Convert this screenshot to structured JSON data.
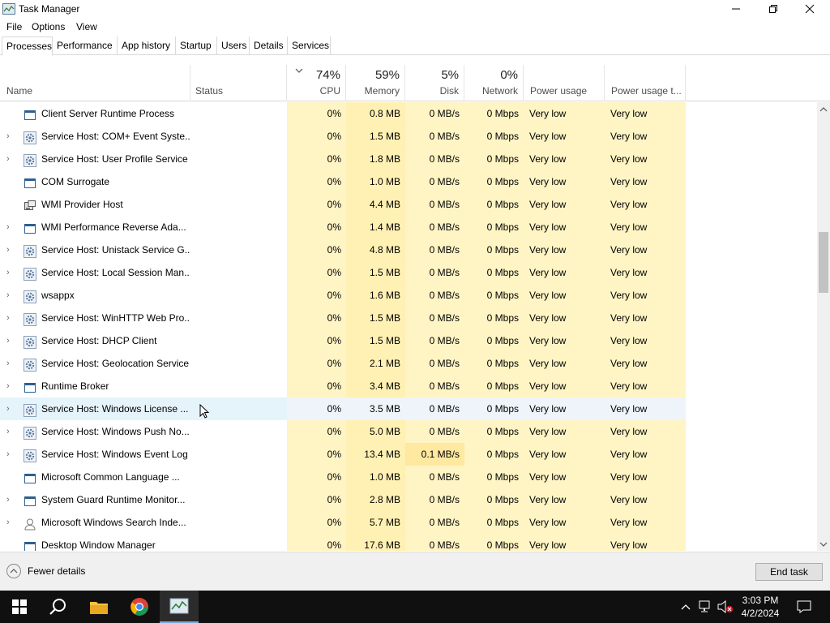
{
  "window": {
    "title": "Task Manager"
  },
  "menu": [
    "File",
    "Options",
    "View"
  ],
  "tabs": [
    "Processes",
    "Performance",
    "App history",
    "Startup",
    "Users",
    "Details",
    "Services"
  ],
  "columns": {
    "name": "Name",
    "status": "Status",
    "cpu": {
      "pct": "74%",
      "label": "CPU"
    },
    "memory": {
      "pct": "59%",
      "label": "Memory"
    },
    "disk": {
      "pct": "5%",
      "label": "Disk"
    },
    "network": {
      "pct": "0%",
      "label": "Network"
    },
    "power": "Power usage",
    "power_trend": "Power usage t..."
  },
  "processes": [
    {
      "expand": false,
      "icon": "window-icon",
      "name": "Client Server Runtime Process",
      "cpu": "0%",
      "mem": "0.8 MB",
      "disk": "0 MB/s",
      "net": "0 Mbps",
      "power": "Very low",
      "power_trend": "Very low"
    },
    {
      "expand": true,
      "icon": "gear-icon",
      "name": "Service Host: COM+ Event Syste...",
      "cpu": "0%",
      "mem": "1.5 MB",
      "disk": "0 MB/s",
      "net": "0 Mbps",
      "power": "Very low",
      "power_trend": "Very low"
    },
    {
      "expand": true,
      "icon": "gear-icon",
      "name": "Service Host: User Profile Service",
      "cpu": "0%",
      "mem": "1.8 MB",
      "disk": "0 MB/s",
      "net": "0 Mbps",
      "power": "Very low",
      "power_trend": "Very low"
    },
    {
      "expand": false,
      "icon": "window-icon",
      "name": "COM Surrogate",
      "cpu": "0%",
      "mem": "1.0 MB",
      "disk": "0 MB/s",
      "net": "0 Mbps",
      "power": "Very low",
      "power_trend": "Very low"
    },
    {
      "expand": false,
      "icon": "wmi-icon",
      "name": "WMI Provider Host",
      "cpu": "0%",
      "mem": "4.4 MB",
      "disk": "0 MB/s",
      "net": "0 Mbps",
      "power": "Very low",
      "power_trend": "Very low"
    },
    {
      "expand": true,
      "icon": "window-icon",
      "name": "WMI Performance Reverse Ada...",
      "cpu": "0%",
      "mem": "1.4 MB",
      "disk": "0 MB/s",
      "net": "0 Mbps",
      "power": "Very low",
      "power_trend": "Very low"
    },
    {
      "expand": true,
      "icon": "gear-icon",
      "name": "Service Host: Unistack Service G...",
      "cpu": "0%",
      "mem": "4.8 MB",
      "disk": "0 MB/s",
      "net": "0 Mbps",
      "power": "Very low",
      "power_trend": "Very low"
    },
    {
      "expand": true,
      "icon": "gear-icon",
      "name": "Service Host: Local Session Man...",
      "cpu": "0%",
      "mem": "1.5 MB",
      "disk": "0 MB/s",
      "net": "0 Mbps",
      "power": "Very low",
      "power_trend": "Very low"
    },
    {
      "expand": true,
      "icon": "gear-icon",
      "name": "wsappx",
      "cpu": "0%",
      "mem": "1.6 MB",
      "disk": "0 MB/s",
      "net": "0 Mbps",
      "power": "Very low",
      "power_trend": "Very low"
    },
    {
      "expand": true,
      "icon": "gear-icon",
      "name": "Service Host: WinHTTP Web Pro...",
      "cpu": "0%",
      "mem": "1.5 MB",
      "disk": "0 MB/s",
      "net": "0 Mbps",
      "power": "Very low",
      "power_trend": "Very low"
    },
    {
      "expand": true,
      "icon": "gear-icon",
      "name": "Service Host: DHCP Client",
      "cpu": "0%",
      "mem": "1.5 MB",
      "disk": "0 MB/s",
      "net": "0 Mbps",
      "power": "Very low",
      "power_trend": "Very low"
    },
    {
      "expand": true,
      "icon": "gear-icon",
      "name": "Service Host: Geolocation Service",
      "cpu": "0%",
      "mem": "2.1 MB",
      "disk": "0 MB/s",
      "net": "0 Mbps",
      "power": "Very low",
      "power_trend": "Very low"
    },
    {
      "expand": true,
      "icon": "window-icon",
      "name": "Runtime Broker",
      "cpu": "0%",
      "mem": "3.4 MB",
      "disk": "0 MB/s",
      "net": "0 Mbps",
      "power": "Very low",
      "power_trend": "Very low"
    },
    {
      "expand": true,
      "icon": "gear-icon",
      "name": "Service Host: Windows License ...",
      "cpu": "0%",
      "mem": "3.5 MB",
      "disk": "0 MB/s",
      "net": "0 Mbps",
      "power": "Very low",
      "power_trend": "Very low",
      "selected": true
    },
    {
      "expand": true,
      "icon": "gear-icon",
      "name": "Service Host: Windows Push No...",
      "cpu": "0%",
      "mem": "5.0 MB",
      "disk": "0 MB/s",
      "net": "0 Mbps",
      "power": "Very low",
      "power_trend": "Very low"
    },
    {
      "expand": true,
      "icon": "gear-icon",
      "name": "Service Host: Windows Event Log",
      "cpu": "0%",
      "mem": "13.4 MB",
      "disk": "0.1 MB/s",
      "net": "0 Mbps",
      "power": "Very low",
      "power_trend": "Very low",
      "disk_hi": true
    },
    {
      "expand": false,
      "icon": "window-icon",
      "name": "Microsoft Common Language ...",
      "cpu": "0%",
      "mem": "1.0 MB",
      "disk": "0 MB/s",
      "net": "0 Mbps",
      "power": "Very low",
      "power_trend": "Very low"
    },
    {
      "expand": true,
      "icon": "window-icon",
      "name": "System Guard Runtime Monitor...",
      "cpu": "0%",
      "mem": "2.8 MB",
      "disk": "0 MB/s",
      "net": "0 Mbps",
      "power": "Very low",
      "power_trend": "Very low"
    },
    {
      "expand": true,
      "icon": "user-search-icon",
      "name": "Microsoft Windows Search Inde...",
      "cpu": "0%",
      "mem": "5.7 MB",
      "disk": "0 MB/s",
      "net": "0 Mbps",
      "power": "Very low",
      "power_trend": "Very low"
    },
    {
      "expand": false,
      "icon": "window-icon",
      "name": "Desktop Window Manager",
      "cpu": "0%",
      "mem": "17.6 MB",
      "disk": "0 MB/s",
      "net": "0 Mbps",
      "power": "Very low",
      "power_trend": "Very low"
    }
  ],
  "footer": {
    "fewer_details": "Fewer details",
    "end_task": "End task"
  },
  "taskbar": {
    "time": "3:03 PM",
    "date": "4/2/2024"
  },
  "colors": {
    "heat_light": "#fff4c4",
    "heat_mid": "#fff0b3",
    "selection": "#e5f3fb",
    "taskbar": "#101010"
  }
}
